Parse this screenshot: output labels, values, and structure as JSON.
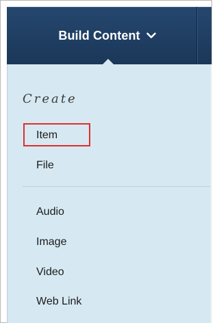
{
  "toolbar": {
    "build_content_label": "Build Content",
    "chevron_icon": "chevron-down-icon",
    "background": "#1b3758"
  },
  "menu": {
    "section_heading": "Create",
    "highlight_color": "#e22b2b",
    "panel_color": "#d6e9f2",
    "group1": [
      {
        "label": "Item",
        "highlighted": true
      },
      {
        "label": "File",
        "highlighted": false
      }
    ],
    "group2": [
      {
        "label": "Audio"
      },
      {
        "label": "Image"
      },
      {
        "label": "Video"
      },
      {
        "label": "Web Link"
      }
    ]
  }
}
